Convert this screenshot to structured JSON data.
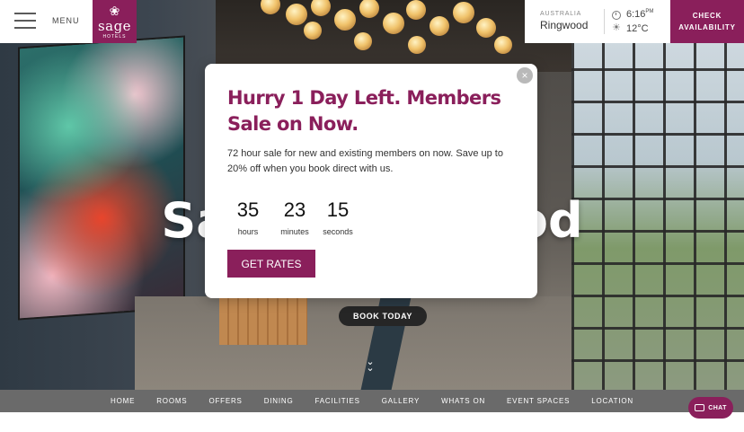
{
  "header": {
    "menu_label": "MENU",
    "logo": {
      "word": "sage",
      "sub": "HOTELS"
    },
    "location": {
      "country": "AUSTRALIA",
      "city": "Ringwood",
      "time": "6:16",
      "ampm": "PM",
      "temperature": "12°C"
    },
    "check_availability_label": "CHECK AVAILABILITY"
  },
  "hero": {
    "title": "Sage Ringwood",
    "book_today_label": "BOOK TODAY"
  },
  "popup": {
    "close_label": "×",
    "title": "Hurry 1 Day Left. Members Sale on Now.",
    "body": "72 hour sale for new and existing members on now. Save up to 20% off when you book direct with us.",
    "countdown": [
      {
        "value": "35",
        "label": "hours"
      },
      {
        "value": "23",
        "label": "minutes"
      },
      {
        "value": "15",
        "label": "seconds"
      }
    ],
    "cta_label": "GET RATES"
  },
  "nav": {
    "items": [
      "HOME",
      "ROOMS",
      "OFFERS",
      "DINING",
      "FACILITIES",
      "GALLERY",
      "WHATS ON",
      "EVENT SPACES",
      "LOCATION"
    ]
  },
  "chat": {
    "label": "CHAT"
  },
  "colors": {
    "brand": "#8a1f5b",
    "nav_bg": "#6a6a6a"
  },
  "icons": [
    "hamburger-icon",
    "logo-mark-icon",
    "clock-icon",
    "sun-icon",
    "close-icon",
    "chevron-down-icon",
    "chat-icon"
  ]
}
